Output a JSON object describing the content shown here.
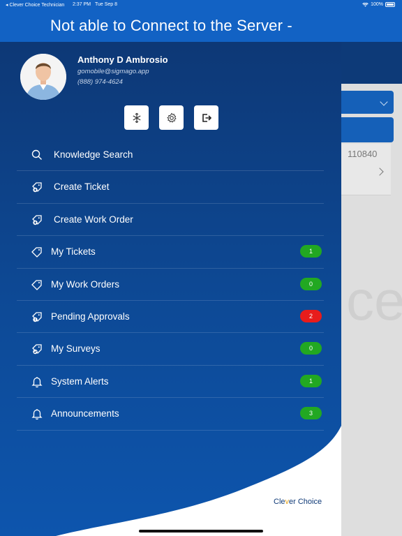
{
  "status_bar": {
    "back_app": "◂ Clever Choice Technician",
    "time": "2:37 PM",
    "date": "Tue Sep 8",
    "battery": "100%"
  },
  "header": {
    "title": "Not able to Connect to the Server -"
  },
  "background": {
    "number": "110840",
    "watermark": "ce"
  },
  "profile": {
    "name": "Anthony D Ambrosio",
    "email": "gomobile@sigmago.app",
    "phone": "(888) 974-4624"
  },
  "actions": [
    {
      "icon": "sync-icon"
    },
    {
      "icon": "gear-icon"
    },
    {
      "icon": "logout-icon"
    }
  ],
  "menu": [
    {
      "label": "Knowledge Search",
      "icon": "search-icon",
      "badge": ""
    },
    {
      "label": "Create Ticket",
      "icon": "ticket-add-icon",
      "badge": ""
    },
    {
      "label": "Create Work Order",
      "icon": "ticket-add-icon",
      "badge": ""
    },
    {
      "label": "My Tickets",
      "icon": "ticket-icon",
      "badge": "1",
      "badge_color": "#22a822"
    },
    {
      "label": "My Work Orders",
      "icon": "ticket-icon",
      "badge": "0",
      "badge_color": "#22a822"
    },
    {
      "label": "Pending Approvals",
      "icon": "ticket-alert-icon",
      "badge": "2",
      "badge_color": "#e81c1c"
    },
    {
      "label": "My Surveys",
      "icon": "ticket-check-icon",
      "badge": "0",
      "badge_color": "#22a822"
    },
    {
      "label": "System Alerts",
      "icon": "bell-icon",
      "badge": "1",
      "badge_color": "#22a822"
    },
    {
      "label": "Announcements",
      "icon": "bell-icon",
      "badge": "3",
      "badge_color": "#22a822"
    }
  ],
  "brand": {
    "text_a": "Cle",
    "text_check": "v",
    "text_b": "er Choice"
  },
  "colors": {
    "primary": "#1262c4",
    "drawer": "#0d4a97",
    "badge_green": "#22a822",
    "badge_red": "#e81c1c"
  }
}
